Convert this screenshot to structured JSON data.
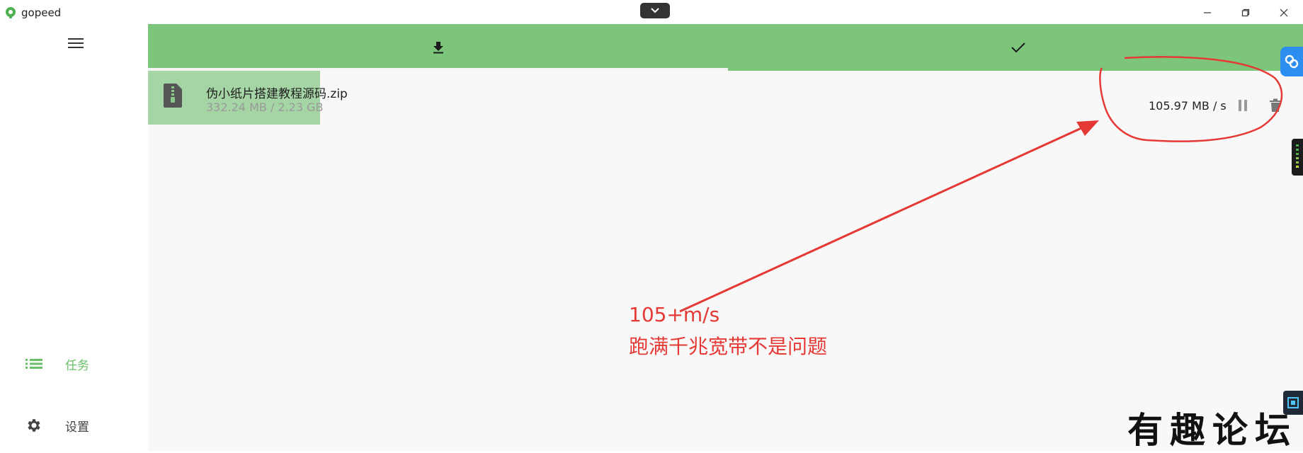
{
  "app": {
    "name": "gopeed"
  },
  "sidebar": {
    "items": [
      {
        "label": "任务",
        "icon": "task-list-icon",
        "active": true
      },
      {
        "label": "设置",
        "icon": "gear-icon",
        "active": false
      }
    ]
  },
  "tabs": [
    {
      "icon": "download-icon",
      "selected": true
    },
    {
      "icon": "check-icon",
      "selected": false
    }
  ],
  "tasks": [
    {
      "name": "伪小纸片搭建教程源码.zip",
      "size": "332.24 MB / 2.23 GB",
      "speed": "105.97 MB / s",
      "progress": 0.149
    }
  ],
  "annotation": {
    "line1": "105+m/s",
    "line2": "跑满千兆宽带不是问题"
  },
  "watermark": "有趣论坛",
  "colors": {
    "accent": "#7cc57b",
    "active_nav": "#6abf69",
    "annotation": "#e53935"
  }
}
